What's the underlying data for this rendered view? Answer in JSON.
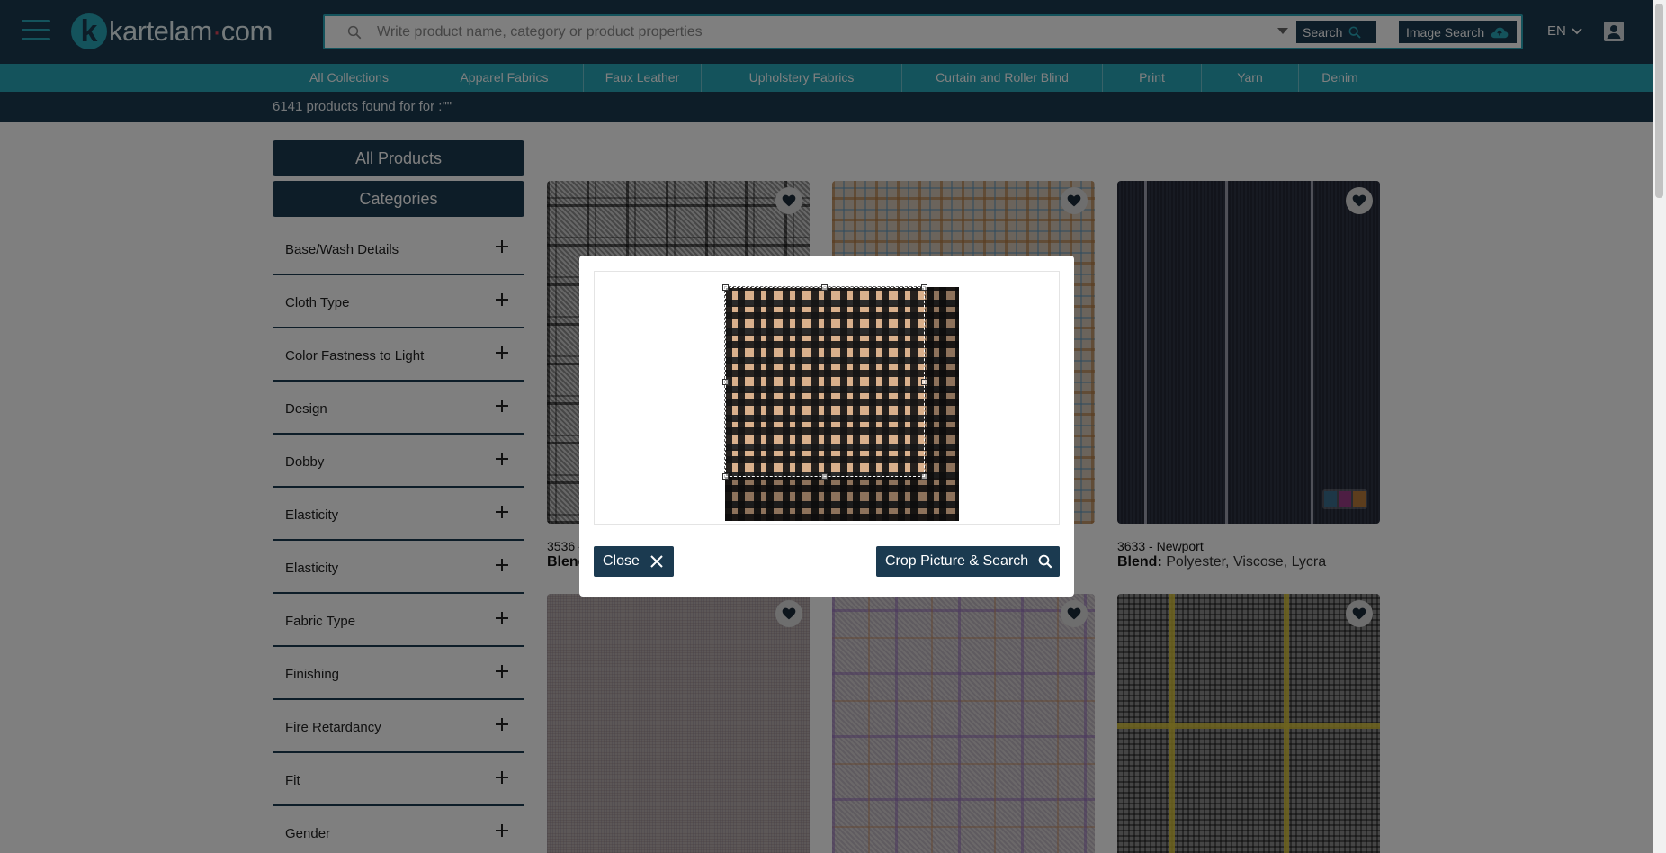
{
  "header": {
    "logo_letter": "k",
    "logo_name": "kartelam",
    "logo_dot": "·",
    "logo_tld": "com",
    "search_placeholder": "Write product name, category or product properties",
    "search_label": "Search",
    "image_search_label": "Image Search",
    "language": "EN"
  },
  "categories": [
    "All Collections",
    "Apparel Fabrics",
    "Faux Leather",
    "Upholstery Fabrics",
    "Curtain and Roller Blind",
    "Print",
    "Yarn",
    "Denim"
  ],
  "results_text": "6141 products found for for :\"\"",
  "sidebar": {
    "all_products": "All Products",
    "categories_label": "Categories",
    "filters": [
      "Base/Wash Details",
      "Cloth Type",
      "Color Fastness to Light",
      "Design",
      "Dobby",
      "Elasticity",
      "Elasticity",
      "Fabric Type",
      "Finishing",
      "Fire Retardancy",
      "Fit",
      "Gender"
    ]
  },
  "products": [
    {
      "title": "3536 -",
      "blend_label": "Blend",
      "blend_value": ""
    },
    {
      "title": "",
      "blend_label": "",
      "blend_value": ""
    },
    {
      "title": "3633 - Newport",
      "blend_label": "Blend:",
      "blend_value": "Polyester, Viscose, Lycra"
    }
  ],
  "swatch_colors": [
    "#3b6f8e",
    "#9a3c86",
    "#b87a3a"
  ],
  "modal": {
    "close_label": "Close",
    "crop_search_label": "Crop Picture & Search"
  },
  "colors": {
    "navy": "#1b3a50",
    "teal": "#28a6b8"
  }
}
